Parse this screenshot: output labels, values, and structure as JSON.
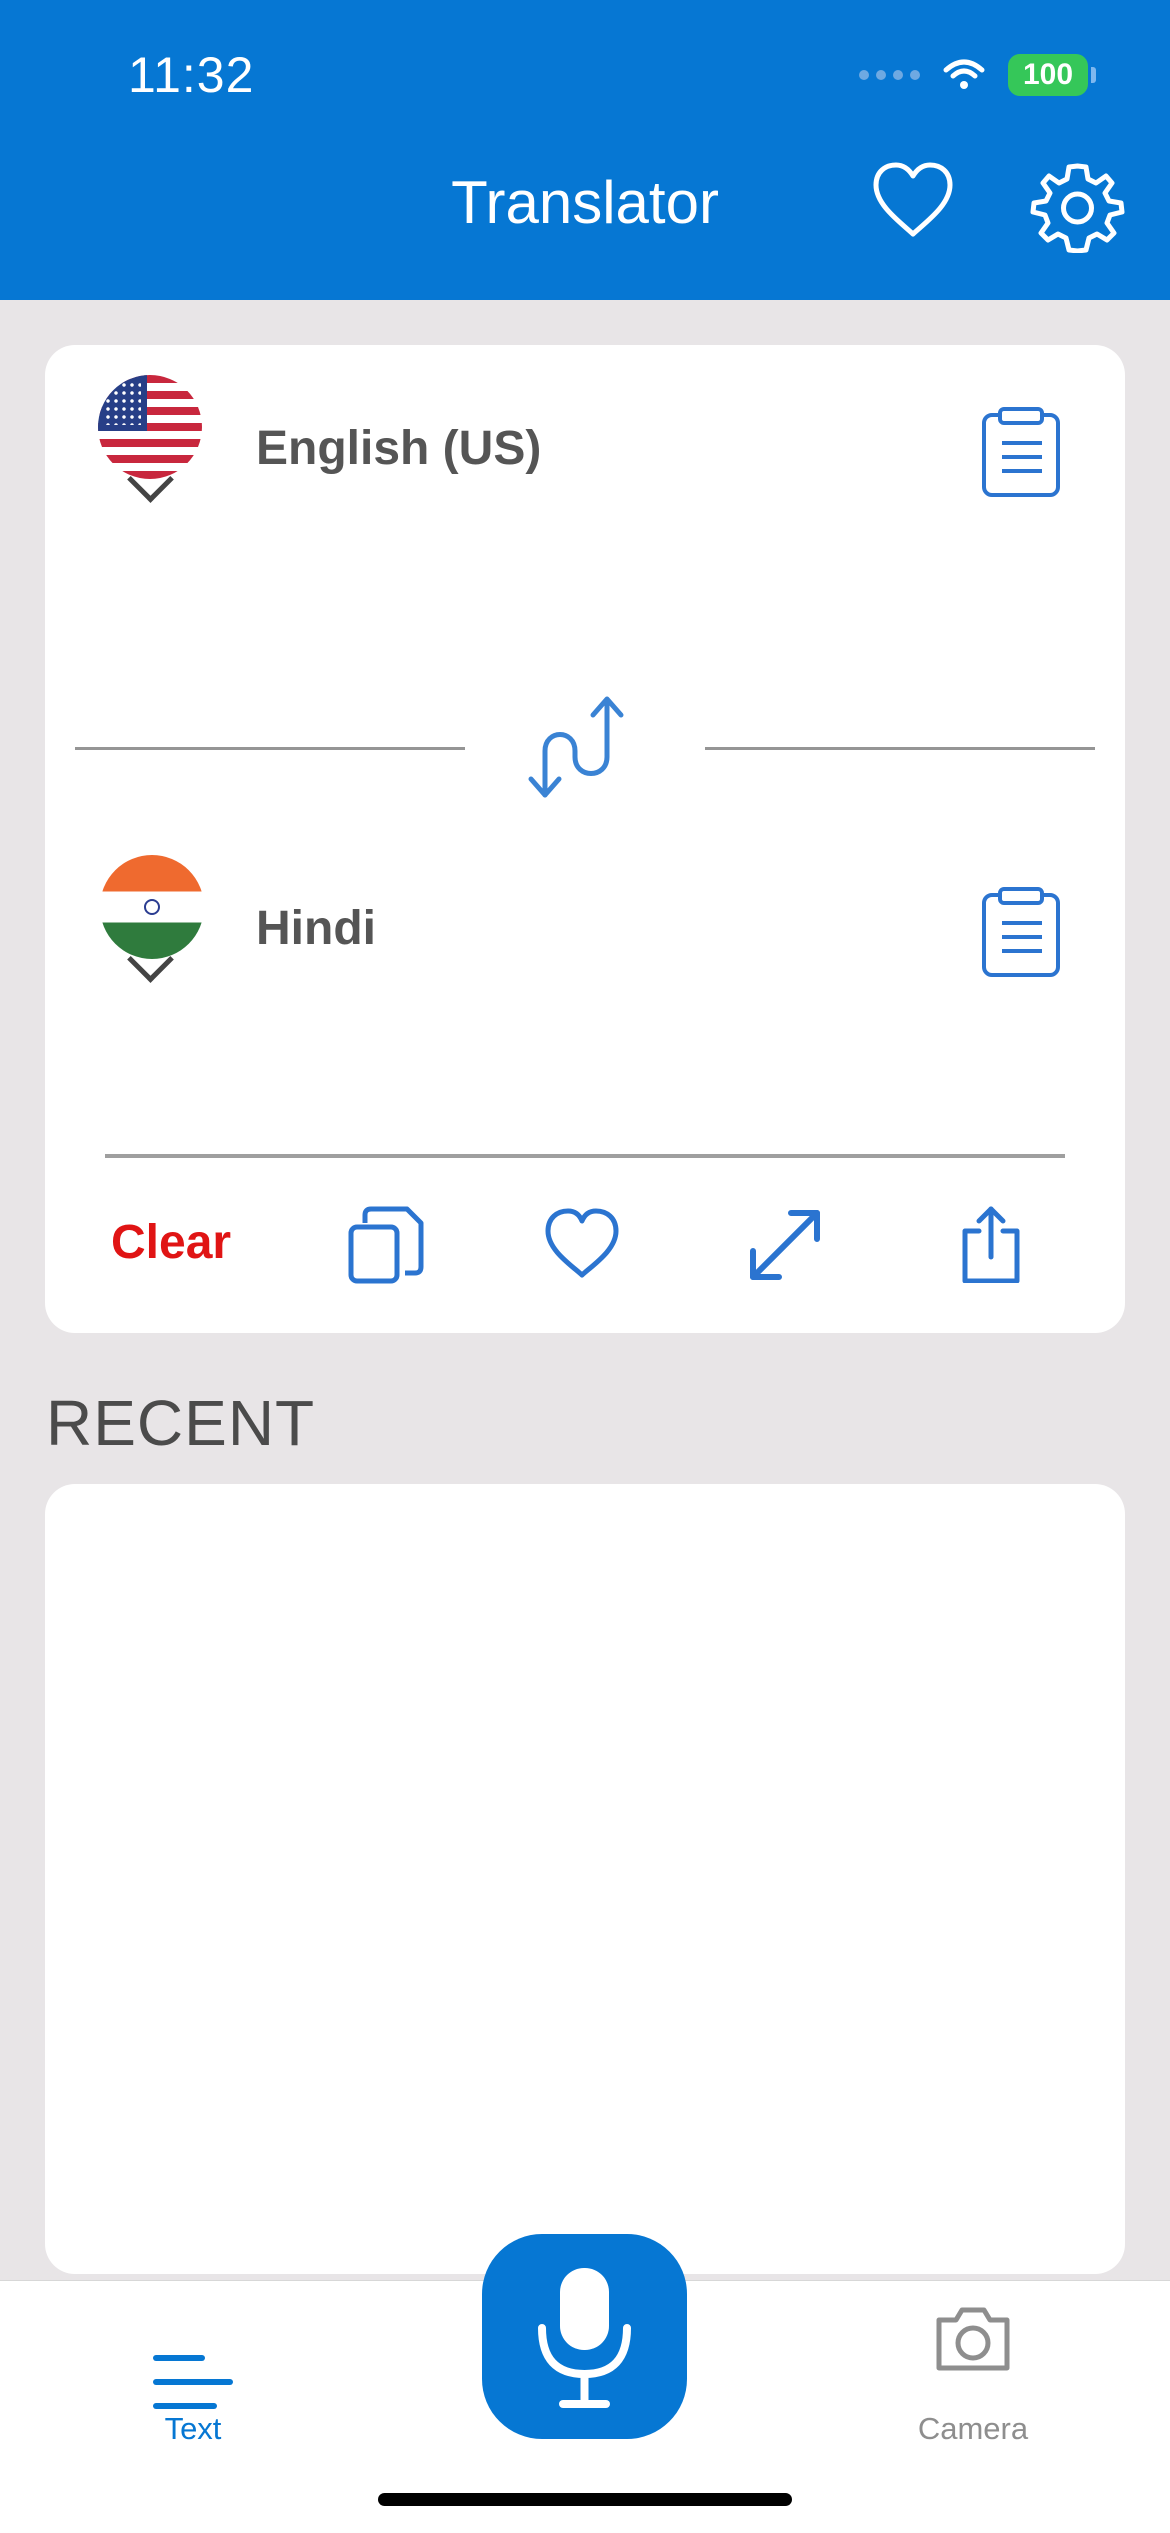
{
  "status_bar": {
    "time": "11:32",
    "battery": "100"
  },
  "header": {
    "title": "Translator",
    "icons": [
      "heart-icon",
      "gear-icon"
    ]
  },
  "translator": {
    "source_language": "English (US)",
    "target_language": "Hindi",
    "action_clear": "Clear",
    "icons": {
      "source_flag": "us-flag-icon",
      "target_flag": "india-flag-icon",
      "clipboard": "clipboard-icon",
      "swap": "swap-icon",
      "copy": "copy-icon",
      "favorite": "heart-icon",
      "expand": "expand-icon",
      "share": "share-icon"
    }
  },
  "recent": {
    "label": "RECENT"
  },
  "tabbar": {
    "text_label": "Text",
    "camera_label": "Camera",
    "icons": [
      "lines-icon",
      "microphone-icon",
      "camera-icon"
    ]
  },
  "colors": {
    "header_blue": "#0677d3",
    "icon_blue": "#2b74d0",
    "clear_red": "#e01414",
    "background": "#e8e5e7"
  }
}
